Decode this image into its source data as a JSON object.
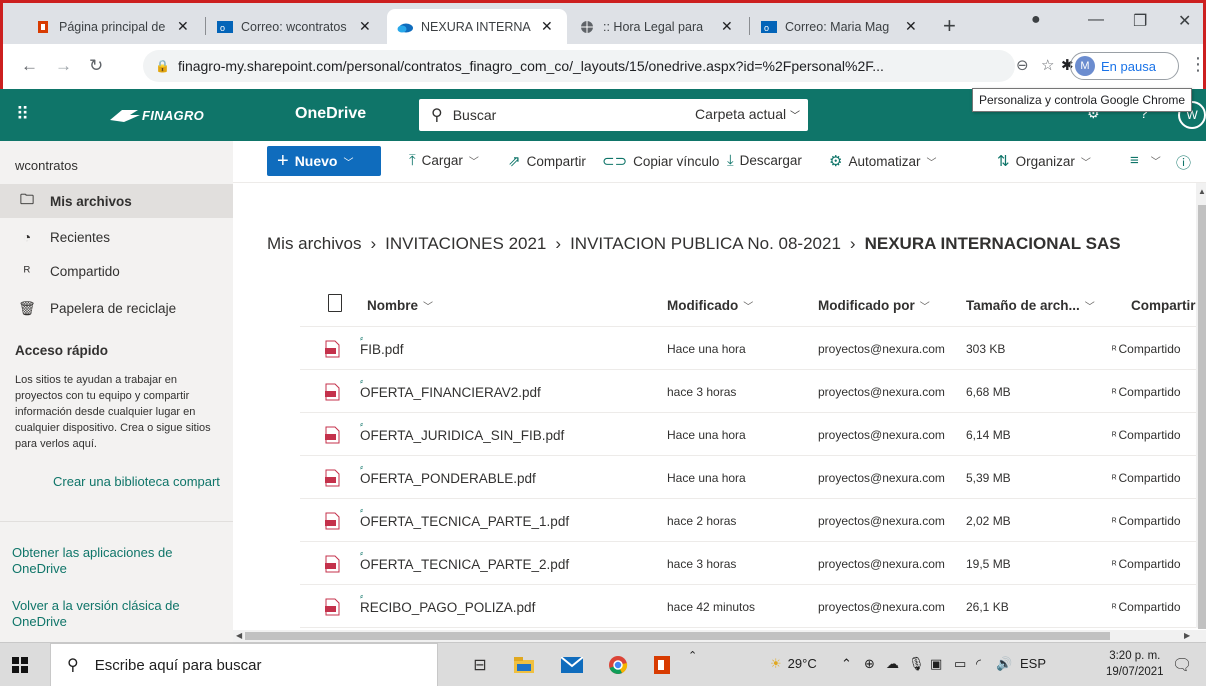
{
  "browser": {
    "tabs": [
      {
        "title": "Página principal de",
        "icon": "office-icon"
      },
      {
        "title": "Correo: wcontratos",
        "icon": "outlook-icon"
      },
      {
        "title": "NEXURA INTERNA",
        "icon": "onedrive-icon",
        "active": true
      },
      {
        "title": ":: Hora Legal para",
        "icon": "globe-icon"
      },
      {
        "title": "Correo: Maria Mag",
        "icon": "outlook-icon"
      }
    ],
    "url": "finagro-my.sharepoint.com/personal/contratos_finagro_com_co/_layouts/15/onedrive.aspx?id=%2Fpersonal%2F...",
    "profile_initial": "M",
    "profile_status": "En pausa",
    "tooltip": "Personaliza y controla Google Chrome"
  },
  "suite": {
    "brand": "FINAGRO",
    "app_name": "OneDrive",
    "search_placeholder": "Buscar",
    "search_scope": "Carpeta actual",
    "user_initial": "W",
    "header_color": "#0f7569"
  },
  "sidebar": {
    "account": "wcontratos",
    "items": [
      {
        "label": "Mis archivos",
        "icon": "folder-icon",
        "selected": true
      },
      {
        "label": "Recientes",
        "icon": "clock-icon"
      },
      {
        "label": "Compartido",
        "icon": "people-icon"
      },
      {
        "label": "Papelera de reciclaje",
        "icon": "trash-icon"
      }
    ],
    "quick_access_title": "Acceso rápido",
    "quick_access_text": "Los sitios te ayudan a trabajar en proyectos con tu equipo y compartir información desde cualquier lugar en cualquier dispositivo. Crea o sigue sitios para verlos aquí.",
    "create_library": "Crear una biblioteca compart",
    "get_apps": "Obtener las aplicaciones de OneDrive",
    "classic": "Volver a la versión clásica de OneDrive"
  },
  "commands": {
    "new": "Nuevo",
    "upload": "Cargar",
    "share": "Compartir",
    "copy_link": "Copiar vínculo",
    "download": "Descargar",
    "automate": "Automatizar",
    "organize": "Organizar"
  },
  "breadcrumb": [
    "Mis archivos",
    "INVITACIONES 2021",
    "INVITACION PUBLICA No. 08-2021",
    "NEXURA INTERNACIONAL SAS"
  ],
  "columns": {
    "name": "Nombre",
    "modified": "Modificado",
    "modified_by": "Modificado por",
    "size": "Tamaño de arch...",
    "sharing": "Compartir"
  },
  "files": [
    {
      "name": "FIB.pdf",
      "modified": "Hace una hora",
      "modified_by": "proyectos@nexura.com",
      "size": "303 KB",
      "sharing": "Compartido"
    },
    {
      "name": "OFERTA_FINANCIERAV2.pdf",
      "modified": "hace 3 horas",
      "modified_by": "proyectos@nexura.com",
      "size": "6,68 MB",
      "sharing": "Compartido"
    },
    {
      "name": "OFERTA_JURIDICA_SIN_FIB.pdf",
      "modified": "Hace una hora",
      "modified_by": "proyectos@nexura.com",
      "size": "6,14 MB",
      "sharing": "Compartido"
    },
    {
      "name": "OFERTA_PONDERABLE.pdf",
      "modified": "Hace una hora",
      "modified_by": "proyectos@nexura.com",
      "size": "5,39 MB",
      "sharing": "Compartido"
    },
    {
      "name": "OFERTA_TECNICA_PARTE_1.pdf",
      "modified": "hace 2 horas",
      "modified_by": "proyectos@nexura.com",
      "size": "2,02 MB",
      "sharing": "Compartido"
    },
    {
      "name": "OFERTA_TECNICA_PARTE_2.pdf",
      "modified": "hace 3 horas",
      "modified_by": "proyectos@nexura.com",
      "size": "19,5 MB",
      "sharing": "Compartido"
    },
    {
      "name": "RECIBO_PAGO_POLIZA.pdf",
      "modified": "hace 42 minutos",
      "modified_by": "proyectos@nexura.com",
      "size": "26,1 KB",
      "sharing": "Compartido"
    }
  ],
  "taskbar": {
    "search_placeholder": "Escribe aquí para buscar",
    "weather": "29°C",
    "language": "ESP",
    "time": "3:20 p. m.",
    "date": "19/07/2021"
  }
}
